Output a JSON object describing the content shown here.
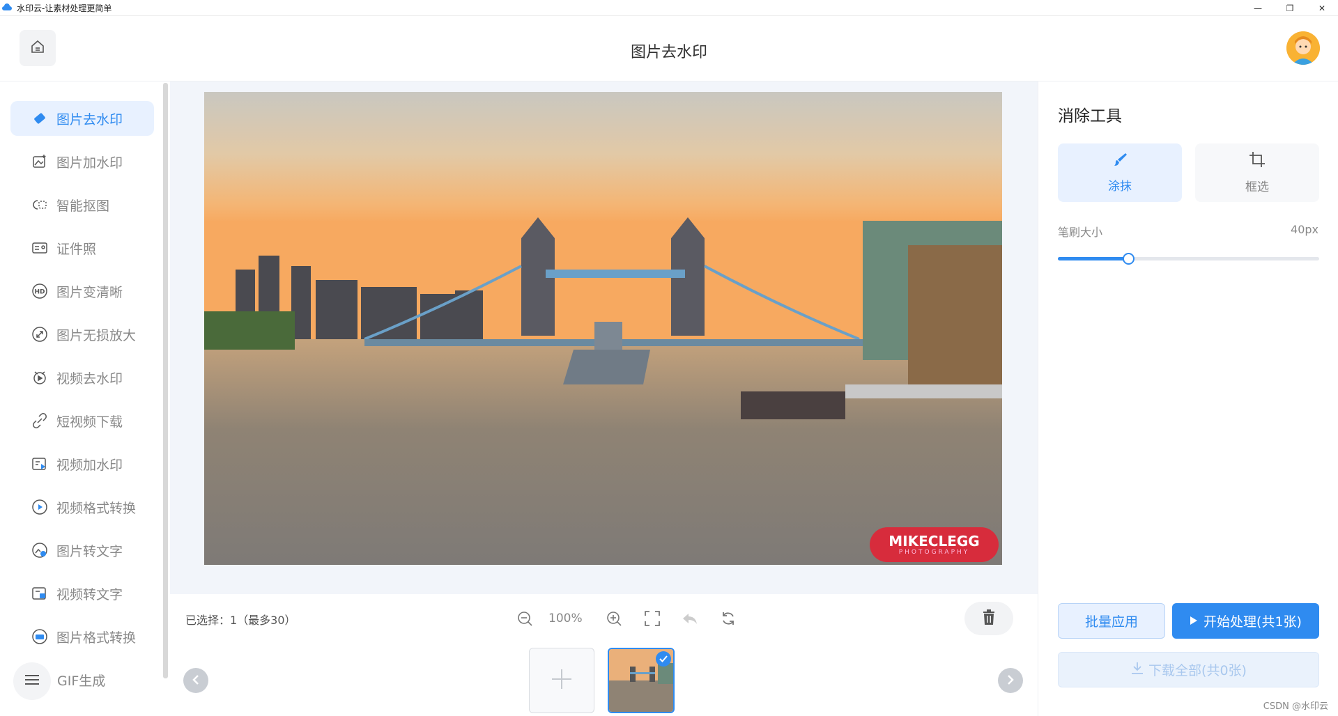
{
  "window": {
    "title": "水印云-让素材处理更简单",
    "controls": [
      "—",
      "❐",
      "✕"
    ]
  },
  "header": {
    "page_title": "图片去水印"
  },
  "sidebar": {
    "items": [
      {
        "label": "图片去水印",
        "icon": "eraser-icon",
        "active": true
      },
      {
        "label": "图片加水印",
        "icon": "image-add-icon",
        "active": false
      },
      {
        "label": "智能抠图",
        "icon": "cutout-icon",
        "active": false
      },
      {
        "label": "证件照",
        "icon": "id-card-icon",
        "active": false
      },
      {
        "label": "图片变清晰",
        "icon": "hd-icon",
        "active": false
      },
      {
        "label": "图片无损放大",
        "icon": "enlarge-icon",
        "active": false
      },
      {
        "label": "视频去水印",
        "icon": "video-eraser-icon",
        "active": false
      },
      {
        "label": "短视频下载",
        "icon": "download-link-icon",
        "active": false
      },
      {
        "label": "视频加水印",
        "icon": "video-add-icon",
        "active": false
      },
      {
        "label": "视频格式转换",
        "icon": "video-convert-icon",
        "active": false
      },
      {
        "label": "图片转文字",
        "icon": "image-text-icon",
        "active": false
      },
      {
        "label": "视频转文字",
        "icon": "video-text-icon",
        "active": false
      },
      {
        "label": "图片格式转换",
        "icon": "jpg-icon",
        "active": false
      },
      {
        "label": "GIF生成",
        "icon": "menu-icon",
        "active": false
      }
    ]
  },
  "canvas": {
    "watermark_text": "MIKECLEGG",
    "watermark_sub": "PHOTOGRAPHY"
  },
  "toolbar": {
    "selection_text": "已选择：1（最多30）",
    "zoom_level": "100%"
  },
  "right_panel": {
    "title": "消除工具",
    "tools": [
      {
        "label": "涂抹",
        "icon": "brush-icon",
        "active": true
      },
      {
        "label": "框选",
        "icon": "crop-icon",
        "active": false
      }
    ],
    "brush_label": "笔刷大小",
    "brush_value": "40px",
    "brush_fraction": 0.27,
    "batch_label": "批量应用",
    "start_label": "开始处理(共1张)",
    "download_label": "下载全部(共0张)"
  },
  "footer": {
    "credit": "CSDN @水印云"
  },
  "colors": {
    "accent": "#2f8bf0",
    "accent_light": "#e8f1ff"
  }
}
